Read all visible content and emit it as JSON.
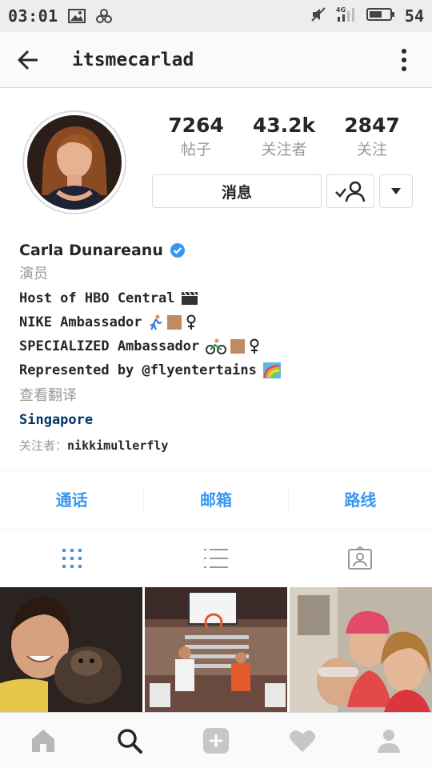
{
  "status_bar": {
    "time": "03:01",
    "network": "4G",
    "battery": "54"
  },
  "header": {
    "username": "itsmecarlad"
  },
  "stats": [
    {
      "value": "7264",
      "label": "帖子"
    },
    {
      "value": "43.2k",
      "label": "关注者"
    },
    {
      "value": "2847",
      "label": "关注"
    }
  ],
  "actions": {
    "message_label": "消息"
  },
  "bio": {
    "name": "Carla Dunareanu",
    "category": "演员",
    "lines": [
      "Host of HBO Central",
      "NIKE Ambassador",
      "SPECIALIZED Ambassador",
      "Represented by @flyentertains"
    ],
    "translate": "查看翻译",
    "location": "Singapore",
    "followed_by_prefix": "关注者：",
    "followed_by_user": "nikkimullerfly"
  },
  "contact": {
    "call": "通话",
    "email": "邮箱",
    "directions": "路线"
  },
  "colors": {
    "accent": "#3897f0",
    "text": "#262626",
    "muted": "#999999",
    "link": "#003569"
  }
}
